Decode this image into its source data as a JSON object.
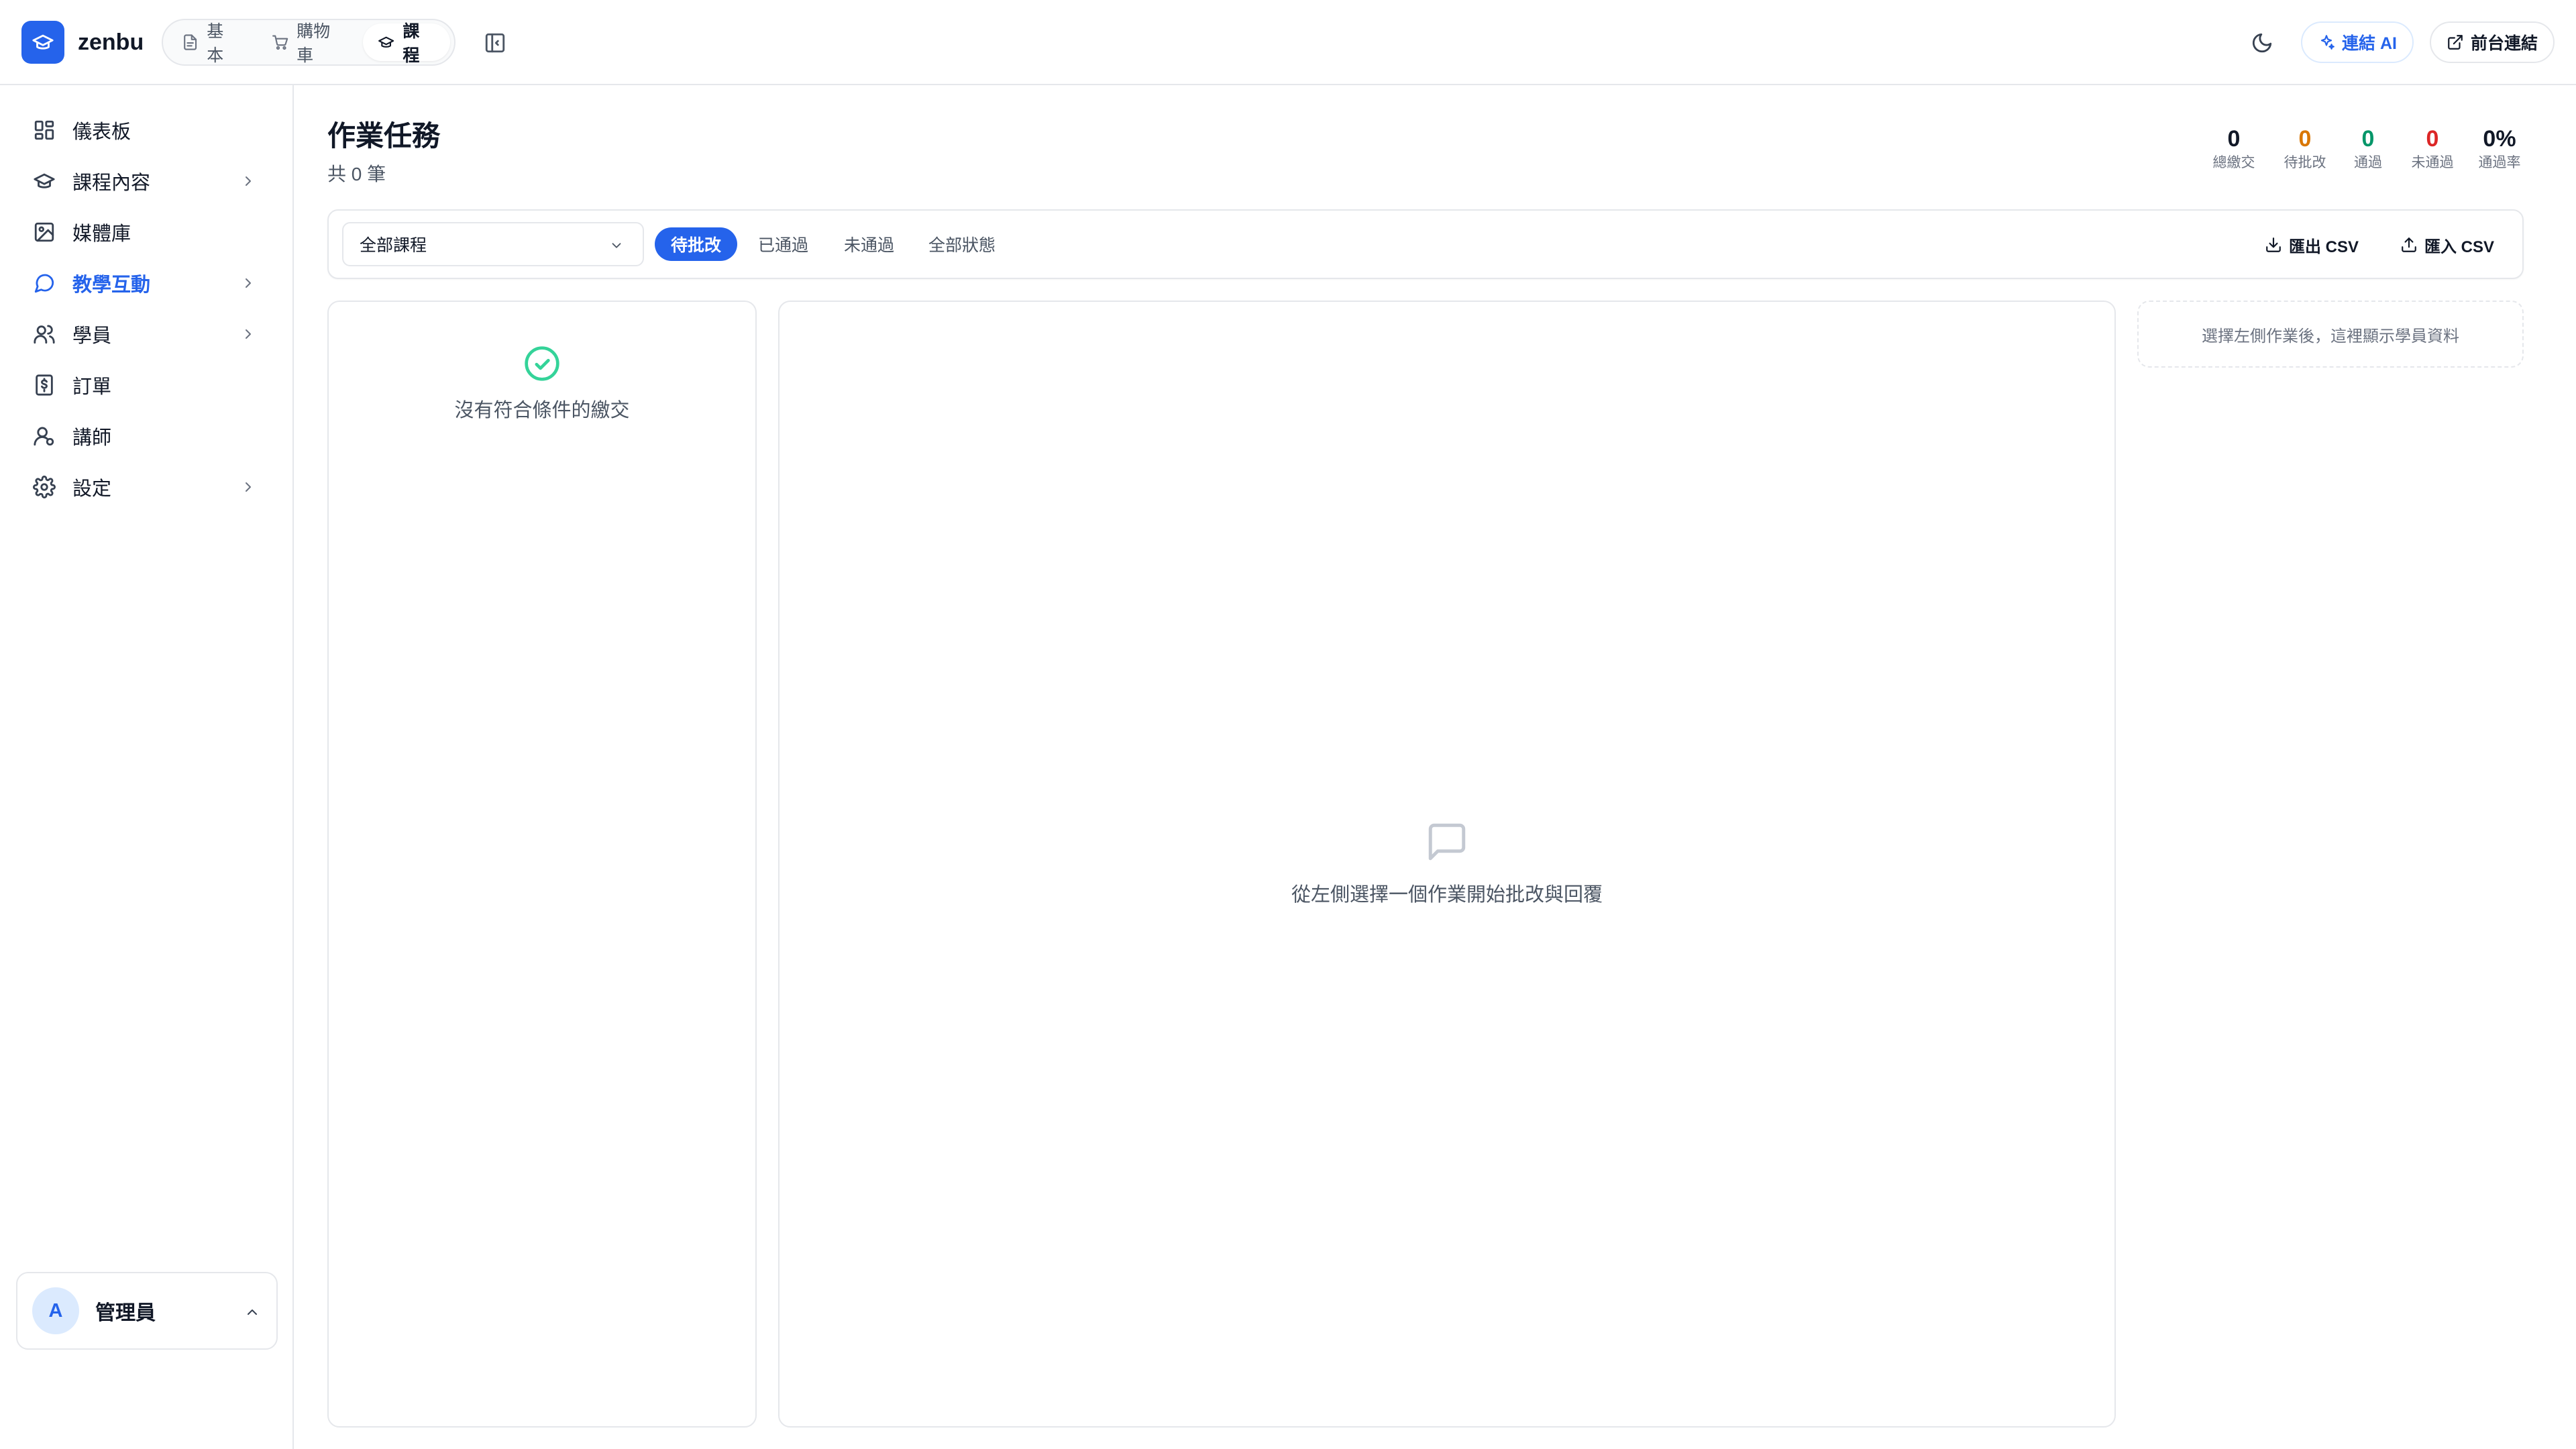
{
  "app": {
    "brand": "zenbu",
    "nav_tabs": [
      {
        "label": "基本",
        "icon": "file-icon",
        "active": false
      },
      {
        "label": "購物車",
        "icon": "cart-icon",
        "active": false
      },
      {
        "label": "課程",
        "icon": "graduation-cap-icon",
        "active": true
      }
    ],
    "actions": {
      "ai_label": "連結 AI",
      "front_label": "前台連結"
    }
  },
  "sidebar": {
    "items": [
      {
        "label": "儀表板",
        "icon": "dashboard-icon",
        "has_children": false,
        "active": false
      },
      {
        "label": "課程內容",
        "icon": "graduation-cap-icon",
        "has_children": true,
        "active": false
      },
      {
        "label": "媒體庫",
        "icon": "image-icon",
        "has_children": false,
        "active": false
      },
      {
        "label": "教學互動",
        "icon": "chat-icon",
        "has_children": true,
        "active": true
      },
      {
        "label": "學員",
        "icon": "users-icon",
        "has_children": true,
        "active": false
      },
      {
        "label": "訂單",
        "icon": "receipt-icon",
        "has_children": false,
        "active": false
      },
      {
        "label": "講師",
        "icon": "instructor-icon",
        "has_children": false,
        "active": false
      },
      {
        "label": "設定",
        "icon": "gear-icon",
        "has_children": true,
        "active": false
      }
    ],
    "user": {
      "initial": "A",
      "name": "管理員"
    }
  },
  "main": {
    "title": "作業任務",
    "count": "共 0 筆",
    "stats": [
      {
        "value": "0",
        "label": "總繳交",
        "color": "#111827"
      },
      {
        "value": "0",
        "label": "待批改",
        "color": "#d97706"
      },
      {
        "value": "0",
        "label": "通過",
        "color": "#059669"
      },
      {
        "value": "0",
        "label": "未通過",
        "color": "#dc2626"
      },
      {
        "value": "0%",
        "label": "通過率",
        "color": "#111827"
      }
    ],
    "filters": {
      "course_select": "全部課程",
      "status_tabs": [
        {
          "label": "待批改",
          "active": true
        },
        {
          "label": "已通過",
          "active": false
        },
        {
          "label": "未通過",
          "active": false
        },
        {
          "label": "全部狀態",
          "active": false
        }
      ],
      "export_label": "匯出 CSV",
      "import_label": "匯入 CSV"
    },
    "left_empty": "沒有符合條件的繳交",
    "center_empty": "從左側選擇一個作業開始批改與回覆",
    "right_hint": "選擇左側作業後，這裡顯示學員資料"
  },
  "colors": {
    "accent": "#2563eb",
    "pending": "#d97706",
    "passed": "#059669",
    "failed": "#dc2626",
    "border": "#e5e7eb"
  }
}
